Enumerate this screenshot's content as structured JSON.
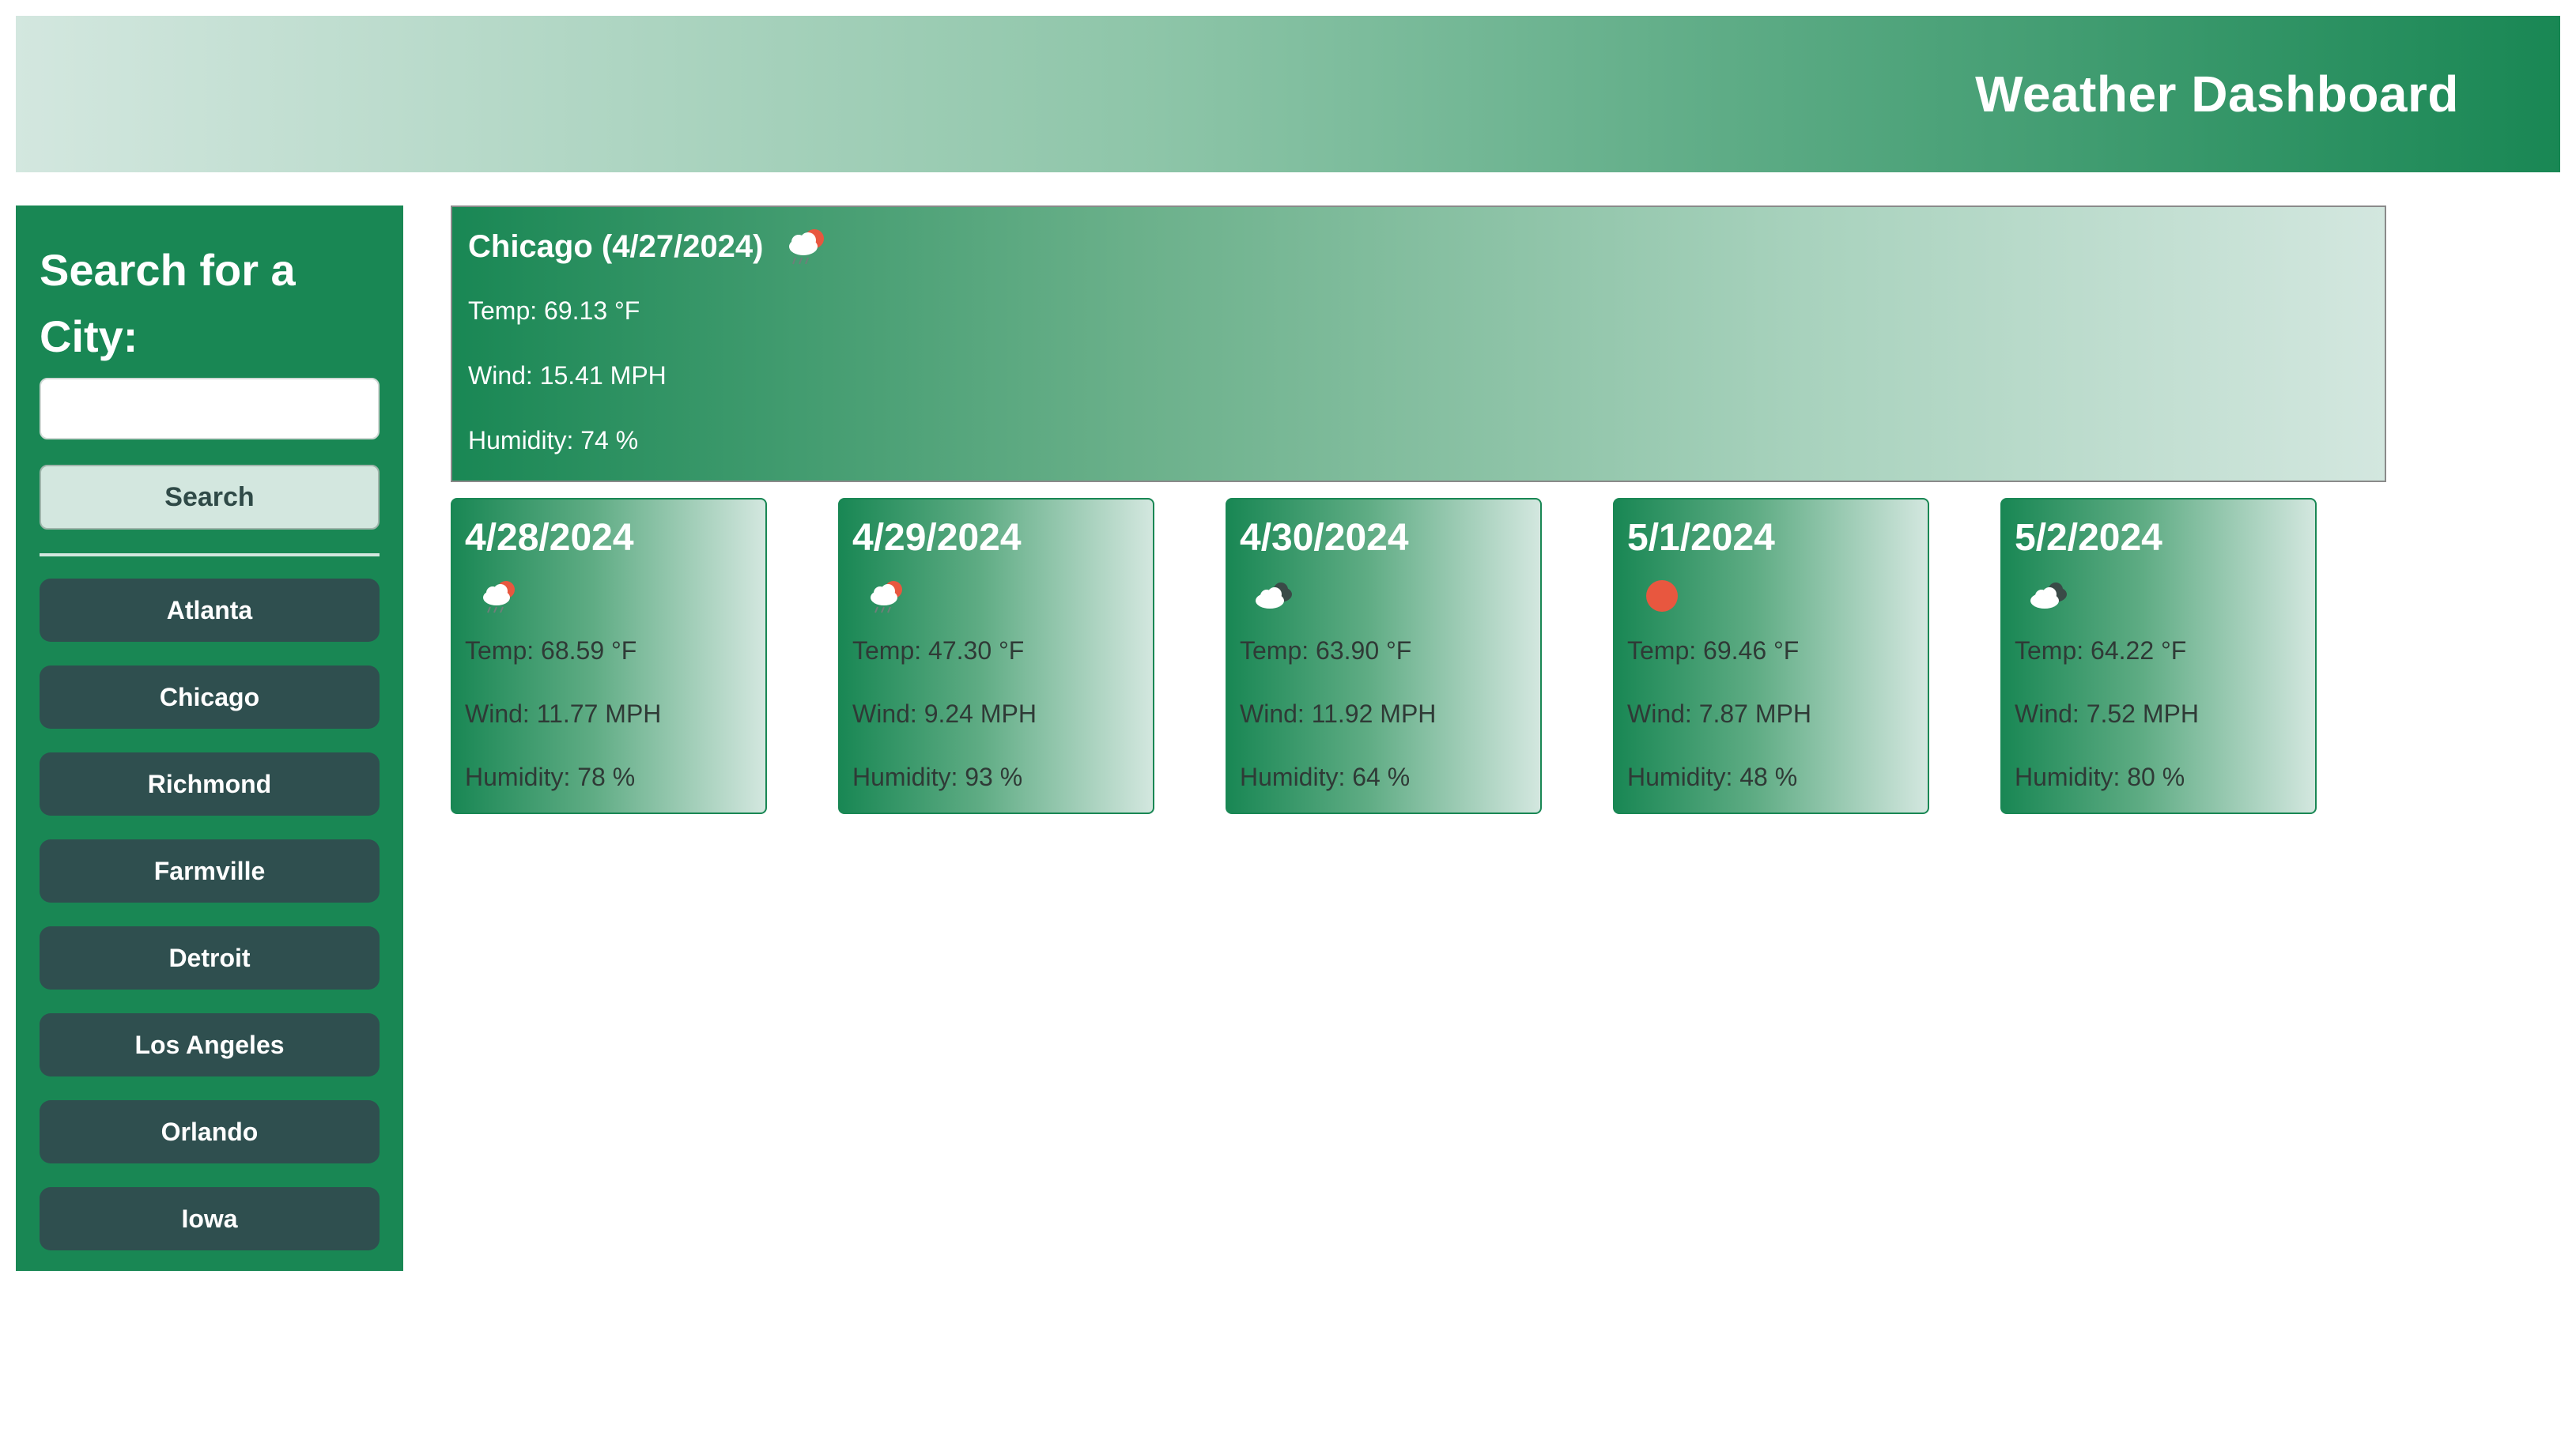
{
  "header": {
    "title": "Weather Dashboard"
  },
  "sidebar": {
    "heading": "Search for a City:",
    "search_placeholder": "",
    "search_value": "",
    "search_button": "Search",
    "history": [
      "Atlanta",
      "Chicago",
      "Richmond",
      "Farmville",
      "Detroit",
      "Los Angeles",
      "Orlando",
      "Iowa"
    ]
  },
  "current": {
    "title": "Chicago (4/27/2024)",
    "icon": "rain-cloud-sun-icon",
    "temp": "Temp: 69.13 °F",
    "wind": "Wind: 15.41 MPH",
    "humidity": "Humidity: 74 %"
  },
  "forecast": [
    {
      "date": "4/28/2024",
      "icon": "rain-cloud-sun-icon",
      "temp": "Temp: 68.59 °F",
      "wind": "Wind: 11.77 MPH",
      "humidity": "Humidity: 78 %"
    },
    {
      "date": "4/29/2024",
      "icon": "rain-cloud-sun-icon",
      "temp": "Temp: 47.30 °F",
      "wind": "Wind: 9.24 MPH",
      "humidity": "Humidity: 93 %"
    },
    {
      "date": "4/30/2024",
      "icon": "broken-clouds-icon",
      "temp": "Temp: 63.90 °F",
      "wind": "Wind: 11.92 MPH",
      "humidity": "Humidity: 64 %"
    },
    {
      "date": "5/1/2024",
      "icon": "sun-icon",
      "temp": "Temp: 69.46 °F",
      "wind": "Wind: 7.87 MPH",
      "humidity": "Humidity: 48 %"
    },
    {
      "date": "5/2/2024",
      "icon": "broken-clouds-icon",
      "temp": "Temp: 64.22 °F",
      "wind": "Wind: 7.52 MPH",
      "humidity": "Humidity: 80 %"
    }
  ],
  "colors": {
    "primary_green": "#198754",
    "light_green": "#d3e7df",
    "history_button": "#2f4f4f",
    "sun": "#e8573f"
  }
}
